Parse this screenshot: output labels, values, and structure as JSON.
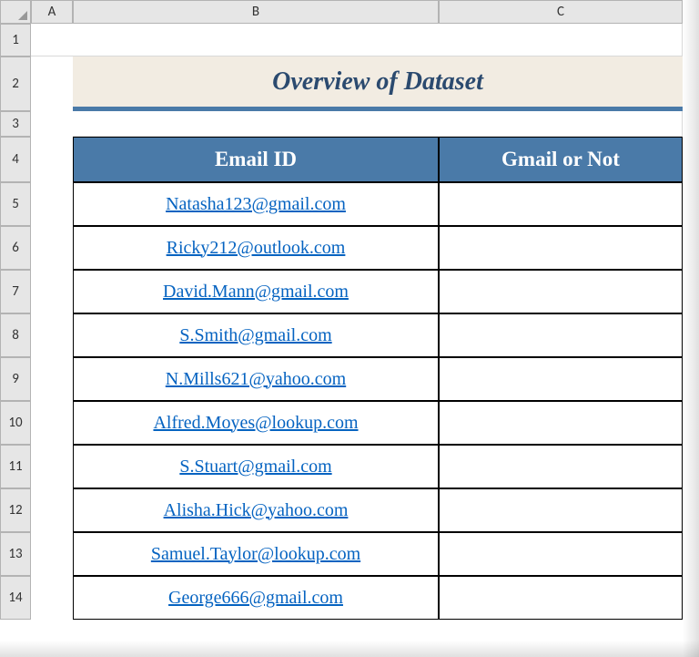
{
  "columns": [
    "A",
    "B",
    "C"
  ],
  "rows": [
    "1",
    "2",
    "3",
    "4",
    "5",
    "6",
    "7",
    "8",
    "9",
    "10",
    "11",
    "12",
    "13",
    "14"
  ],
  "title": "Overview of Dataset",
  "headers": {
    "email": "Email ID",
    "gmail": "Gmail or Not"
  },
  "data": [
    {
      "email": "Natasha123@gmail.com",
      "gmail": ""
    },
    {
      "email": "Ricky212@outlook.com",
      "gmail": ""
    },
    {
      "email": "David.Mann@gmail.com",
      "gmail": ""
    },
    {
      "email": "S.Smith@gmail.com",
      "gmail": ""
    },
    {
      "email": "N.Mills621@yahoo.com",
      "gmail": ""
    },
    {
      "email": "Alfred.Moyes@lookup.com",
      "gmail": ""
    },
    {
      "email": "S.Stuart@gmail.com",
      "gmail": ""
    },
    {
      "email": "Alisha.Hick@yahoo.com",
      "gmail": ""
    },
    {
      "email": "Samuel.Taylor@lookup.com",
      "gmail": ""
    },
    {
      "email": "George666@gmail.com",
      "gmail": ""
    }
  ]
}
